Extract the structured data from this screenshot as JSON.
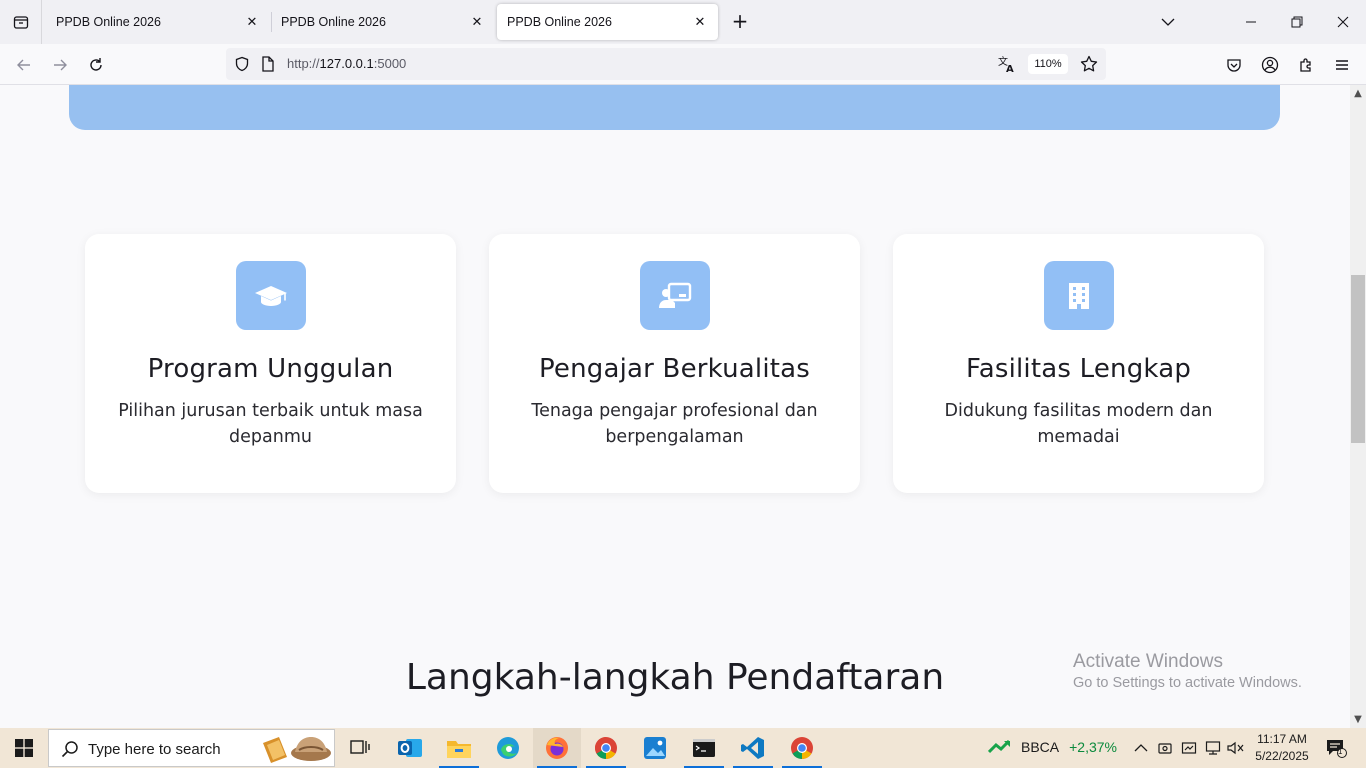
{
  "browser": {
    "tabs": [
      {
        "title": "PPDB Online 2026",
        "active": false
      },
      {
        "title": "PPDB Online 2026",
        "active": false
      },
      {
        "title": "PPDB Online 2026",
        "active": true
      }
    ],
    "url": {
      "scheme": "http://",
      "host": "127.0.0.1",
      "port": ":5000"
    },
    "zoom": "110%"
  },
  "page": {
    "features": [
      {
        "icon": "graduation-cap-icon",
        "title": "Program Unggulan",
        "description": "Pilihan jurusan terbaik untuk masa depanmu"
      },
      {
        "icon": "teacher-board-icon",
        "title": "Pengajar Berkualitas",
        "description": "Tenaga pengajar profesional dan berpengalaman"
      },
      {
        "icon": "building-icon",
        "title": "Fasilitas Lengkap",
        "description": "Didukung fasilitas modern dan memadai"
      }
    ],
    "steps_heading": "Langkah-langkah Pendaftaran"
  },
  "watermark": {
    "title": "Activate Windows",
    "subtitle": "Go to Settings to activate Windows."
  },
  "taskbar": {
    "search_placeholder": "Type here to search",
    "apps": [
      "task-view",
      "outlook",
      "file-explorer",
      "edge",
      "firefox",
      "chrome",
      "photos",
      "terminal",
      "vscode",
      "chrome"
    ],
    "stock": {
      "ticker": "BBCA",
      "change": "+2,37%"
    },
    "clock": {
      "time": "11:17 AM",
      "date": "5/22/2025"
    },
    "notification_count": "1"
  },
  "colors": {
    "accent": "#92bff5",
    "hero": "#97c0f0",
    "taskbar": "#f1e6d6"
  }
}
